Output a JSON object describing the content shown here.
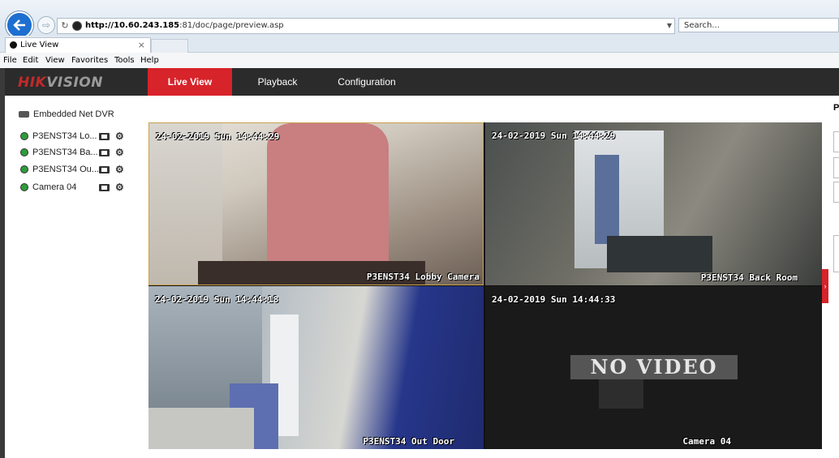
{
  "browser": {
    "url_host": "http://10.60.243.185",
    "url_rest": ":81/doc/page/preview.asp",
    "search_placeholder": "Search...",
    "tab_title": "Live View",
    "tab_close": "×",
    "menu": [
      "File",
      "Edit",
      "View",
      "Favorites",
      "Tools",
      "Help"
    ]
  },
  "app": {
    "logo_hik": "HIK",
    "logo_vision": "VISION",
    "nav": [
      "Live View",
      "Playback",
      "Configuration"
    ],
    "active_nav": "Live View"
  },
  "sidebar": {
    "device": "Embedded Net DVR",
    "cameras": [
      "P3ENST34 Lo...",
      "P3ENST34 Ba...",
      "P3ENST34 Ou...",
      "Camera 04"
    ]
  },
  "tiles": [
    {
      "timestamp": "24-02-2019 Sun 14:44:29",
      "name": "P3ENST34 Lobby Camera"
    },
    {
      "timestamp": "24-02-2019 Sun 14:44:29",
      "name": "P3ENST34 Back Room"
    },
    {
      "timestamp": "24-02-2019 Sun 14:44:18",
      "name": "P3ENST34 Out Door"
    },
    {
      "timestamp": "24-02-2019 Sun 14:44:33",
      "name": "Camera 04",
      "status": "NO VIDEO"
    }
  ],
  "right_panel": {
    "title": "P"
  },
  "colors": {
    "accent": "#d7232a",
    "header_bg": "#2b2b2b"
  }
}
